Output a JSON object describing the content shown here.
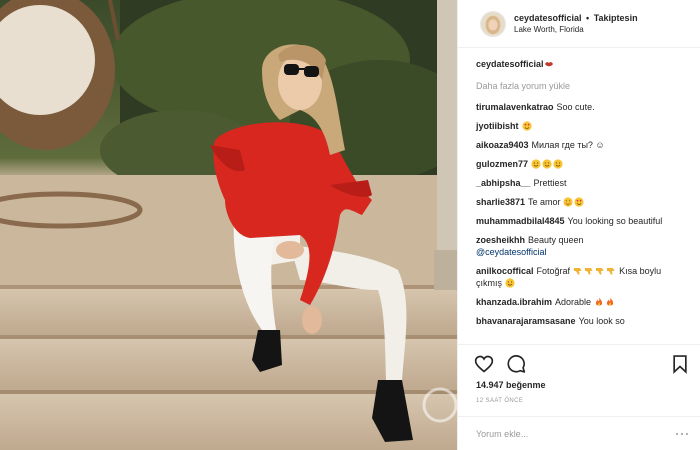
{
  "header": {
    "username": "ceydatesofficial",
    "separator": "•",
    "follow_label": "Takiptesin",
    "location": "Lake Worth, Florida"
  },
  "caption": {
    "username": "ceydatesofficial",
    "emoji": "lips-icon"
  },
  "load_more": "Daha fazla yorum yükle",
  "comments": [
    {
      "username": "tirumalavenkatrao",
      "text": "Soo cute."
    },
    {
      "username": "jyotiibisht",
      "text": "",
      "emoji": [
        "heart-eyes-emoji"
      ]
    },
    {
      "username": "aikoaza9403",
      "text": "Милая где ты? ☺"
    },
    {
      "username": "gulozmen77",
      "text": "",
      "emoji": [
        "smile-emoji",
        "smile-emoji",
        "smile-emoji"
      ]
    },
    {
      "username": "_abhipsha__",
      "text": "Prettiest"
    },
    {
      "username": "sharlie3871",
      "text": "Te amor",
      "emoji": [
        "blush-emoji",
        "heart-eyes-emoji"
      ]
    },
    {
      "username": "muhammadbilal4845",
      "text": "You looking so beautiful"
    },
    {
      "username": "zoesheikhh",
      "text": "Beauty queen",
      "mention": "@ceydatesofficial"
    },
    {
      "username": "anilkocoffical",
      "text_before": "Fotoğraf",
      "emoji": [
        "thumbs-down-emoji",
        "thumbs-down-emoji",
        "thumbs-down-emoji",
        "thumbs-down-emoji"
      ],
      "text_after": "Kısa boylu çıkmış",
      "emoji_end": [
        "smile-emoji"
      ]
    },
    {
      "username": "khanzada.ibrahim",
      "text": "Adorable",
      "emoji": [
        "fire-emoji",
        "fire-emoji"
      ]
    },
    {
      "username": "bhavanarajaramsasane",
      "text": "You look so"
    }
  ],
  "actions": {
    "like_icon": "heart-icon",
    "comment_icon": "comment-icon",
    "save_icon": "bookmark-icon"
  },
  "likes": "14.947 beğenme",
  "timestamp": "12 SAAT ÖNCE",
  "comment_input": {
    "placeholder": "Yorum ekle...",
    "value": ""
  },
  "colors": {
    "text": "#262626",
    "muted": "#999999",
    "mention": "#003569",
    "divider": "#efefef",
    "sweater": "#d8271f"
  }
}
